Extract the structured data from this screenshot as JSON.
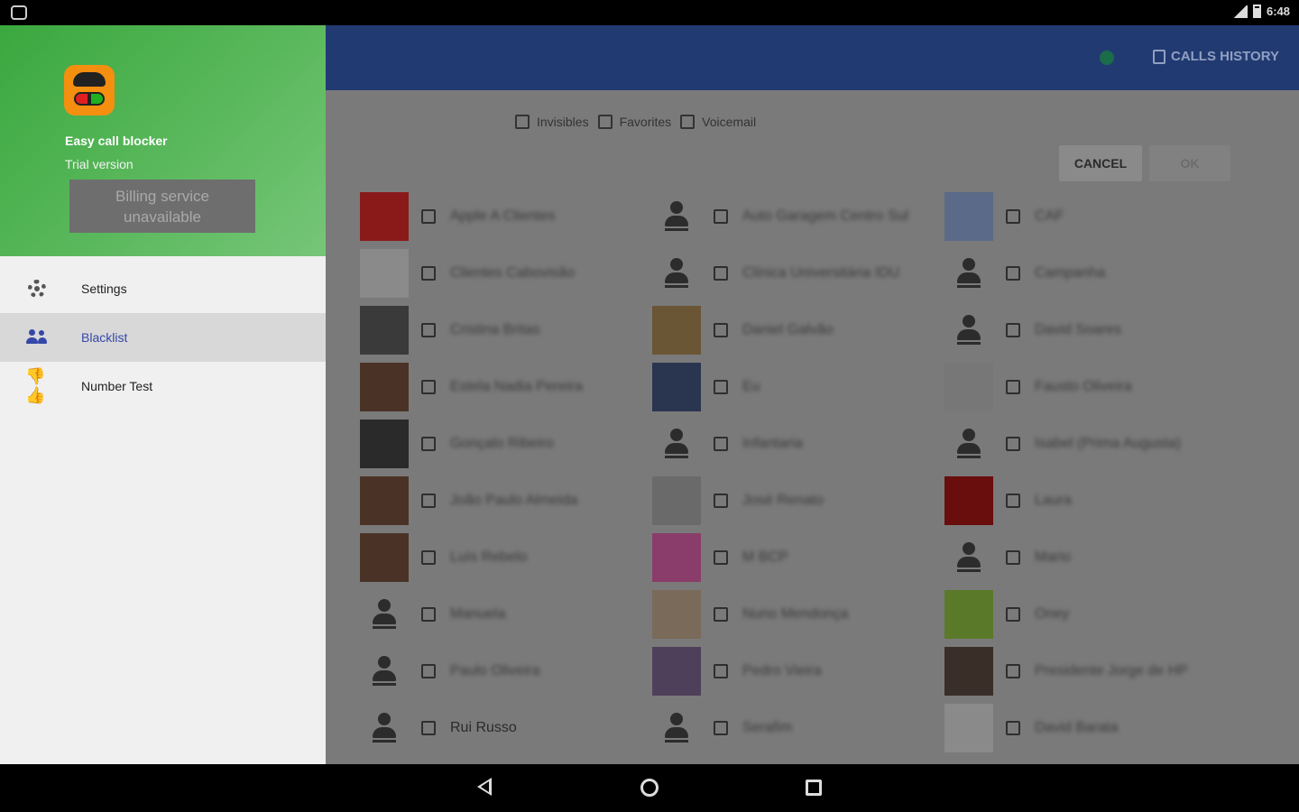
{
  "status_bar": {
    "time": "6:48"
  },
  "toolbar": {
    "calls_history_label": "CALLS HISTORY"
  },
  "filters": [
    {
      "label": "Invisibles"
    },
    {
      "label": "Favorites"
    },
    {
      "label": "Voicemail"
    }
  ],
  "dialog": {
    "cancel_label": "CANCEL",
    "ok_label": "OK"
  },
  "contacts": {
    "col1": [
      {
        "name": "Apple A Clientes",
        "avatar": "photo-red"
      },
      {
        "name": "Clientes Cabovisão",
        "avatar": "photo-logo"
      },
      {
        "name": "Cristina Britas",
        "avatar": "photo-gray"
      },
      {
        "name": "Estela Nadia Pereira",
        "avatar": "photo-brown"
      },
      {
        "name": "Gonçalo Ribeiro",
        "avatar": "photo-dark"
      },
      {
        "name": "João Paulo Almeida",
        "avatar": "photo-brown"
      },
      {
        "name": "Luís Rebelo",
        "avatar": "photo-brown"
      },
      {
        "name": "Manuela",
        "avatar": "person-icon"
      },
      {
        "name": "Paulo Oliveira",
        "avatar": "person-icon"
      },
      {
        "name": "Rui Russo",
        "avatar": "person-icon"
      }
    ],
    "col2": [
      {
        "name": "Auto Garagem Centro Sul",
        "avatar": "person-icon"
      },
      {
        "name": "Clínica Universitária IDU",
        "avatar": "person-icon"
      },
      {
        "name": "Daniel Galvão",
        "avatar": "photo-tan"
      },
      {
        "name": "Eu",
        "avatar": "photo-blue"
      },
      {
        "name": "Infantaria",
        "avatar": "person-icon"
      },
      {
        "name": "José Renato",
        "avatar": "photo-qr"
      },
      {
        "name": "M BCP",
        "avatar": "photo-m"
      },
      {
        "name": "Nuno Mendonça",
        "avatar": "photo-cartoon"
      },
      {
        "name": "Pedro Vieira",
        "avatar": "photo-purple"
      },
      {
        "name": "Serafim",
        "avatar": "person-icon"
      }
    ],
    "col3": [
      {
        "name": "CAF",
        "avatar": "photo-blueish"
      },
      {
        "name": "Campanha",
        "avatar": "person-icon"
      },
      {
        "name": "David Soares",
        "avatar": "person-icon"
      },
      {
        "name": "Fausto Oliveira",
        "avatar": "photo-figure"
      },
      {
        "name": "Isabel (Prima Augusta)",
        "avatar": "person-icon"
      },
      {
        "name": "Laura",
        "avatar": "photo-redblack"
      },
      {
        "name": "Mario",
        "avatar": "person-icon"
      },
      {
        "name": "Oney",
        "avatar": "photo-green"
      },
      {
        "name": "Presidente Jorge de HP",
        "avatar": "photo-face"
      },
      {
        "name": "David Barata",
        "avatar": "photo-mascot"
      }
    ]
  },
  "drawer": {
    "app_name": "Easy call blocker",
    "app_subtitle": "Trial version",
    "billing_line1": "Billing service",
    "billing_line2": "unavailable",
    "items": [
      {
        "label": "Settings",
        "icon": "gear-icon"
      },
      {
        "label": "Blacklist",
        "icon": "people-icon"
      },
      {
        "label": "Number Test",
        "icon": "thumbs-icon"
      }
    ]
  },
  "colors": {
    "drawer_header": "#4caf50",
    "toolbar": "#223a72",
    "active_accent": "#3547a8",
    "app_logo": "#f48f10"
  }
}
